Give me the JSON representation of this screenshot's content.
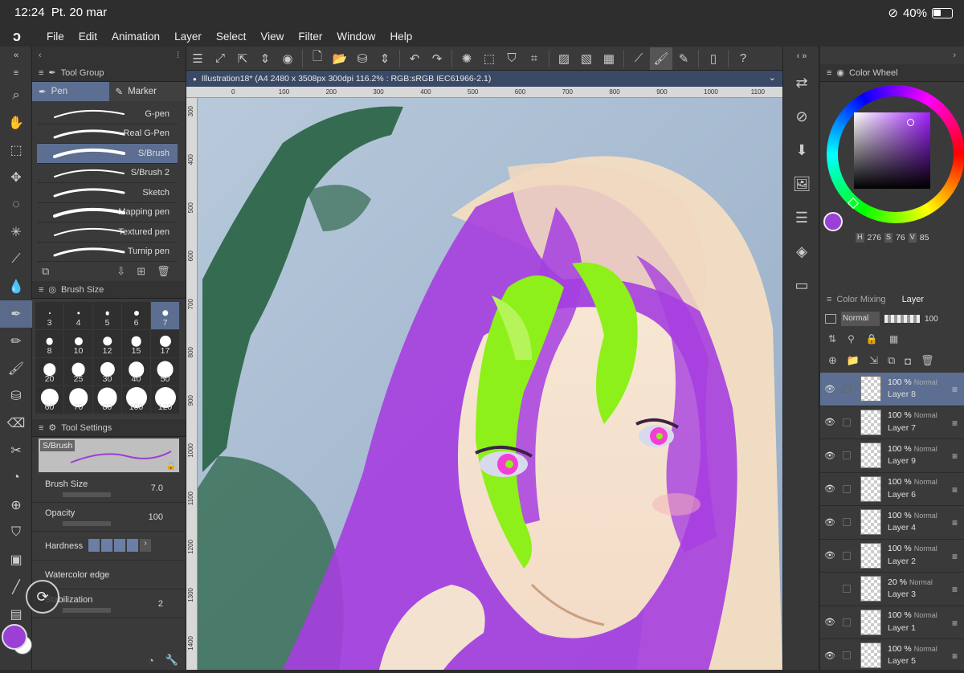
{
  "status": {
    "time": "12:24",
    "date": "Pt. 20 mar",
    "battery": "40%"
  },
  "menu": [
    "File",
    "Edit",
    "Animation",
    "Layer",
    "Select",
    "View",
    "Filter",
    "Window",
    "Help"
  ],
  "document": {
    "title": "Illustration18* (A4 2480 x 3508px 300dpi 116.2% : RGB:sRGB IEC61966-2.1)"
  },
  "ruler_h": [
    "0",
    "100",
    "200",
    "300",
    "400",
    "500",
    "600",
    "700",
    "800",
    "900",
    "1000",
    "1100"
  ],
  "ruler_v": [
    "300",
    "400",
    "500",
    "600",
    "700",
    "800",
    "900",
    "1000",
    "1100",
    "1200",
    "1300",
    "1400"
  ],
  "tool_group": {
    "title": "Tool Group",
    "tabs": [
      {
        "label": "Pen",
        "active": true
      },
      {
        "label": "Marker",
        "active": false
      }
    ],
    "brushes": [
      {
        "label": "G-pen",
        "active": false
      },
      {
        "label": "Real G-Pen",
        "active": false
      },
      {
        "label": "S/Brush",
        "active": true
      },
      {
        "label": "S/Brush 2",
        "active": false
      },
      {
        "label": "Sketch",
        "active": false
      },
      {
        "label": "Mapping pen",
        "active": false
      },
      {
        "label": "Textured pen",
        "active": false
      },
      {
        "label": "Turnip pen",
        "active": false
      }
    ]
  },
  "brush_size": {
    "title": "Brush Size",
    "sizes": [
      "3",
      "4",
      "5",
      "6",
      "7",
      "8",
      "10",
      "12",
      "15",
      "17",
      "20",
      "25",
      "30",
      "40",
      "50",
      "60",
      "70",
      "80",
      "100",
      "120"
    ],
    "selected": "7"
  },
  "tool_settings": {
    "title": "Tool Settings",
    "brush_name": "S/Brush",
    "rows": [
      {
        "label": "Brush Size",
        "value": "7.0"
      },
      {
        "label": "Opacity",
        "value": "100"
      },
      {
        "label": "Hardness",
        "value": ""
      },
      {
        "label": "Watercolor edge",
        "value": ""
      },
      {
        "label": "Stabilization",
        "value": "2"
      }
    ]
  },
  "color_wheel": {
    "title": "Color Wheel",
    "h_label": "H",
    "h": "276",
    "s_label": "S",
    "s": "76",
    "v_label": "V",
    "v": "85",
    "main_color": "#9b3fd6"
  },
  "layer_panel": {
    "tabs": [
      "Color Mixing",
      "Layer"
    ],
    "blend_mode": "Normal",
    "opacity": "100",
    "layers": [
      {
        "pct": "100 %",
        "mode": "Normal",
        "name": "Layer 8",
        "active": true,
        "visible": true
      },
      {
        "pct": "100 %",
        "mode": "Normal",
        "name": "Layer 7",
        "active": false,
        "visible": true
      },
      {
        "pct": "100 %",
        "mode": "Normal",
        "name": "Layer 9",
        "active": false,
        "visible": true
      },
      {
        "pct": "100 %",
        "mode": "Normal",
        "name": "Layer 6",
        "active": false,
        "visible": true
      },
      {
        "pct": "100 %",
        "mode": "Normal",
        "name": "Layer 4",
        "active": false,
        "visible": true
      },
      {
        "pct": "100 %",
        "mode": "Normal",
        "name": "Layer 2",
        "active": false,
        "visible": true
      },
      {
        "pct": "20 %",
        "mode": "Normal",
        "name": "Layer 3",
        "active": false,
        "visible": false
      },
      {
        "pct": "100 %",
        "mode": "Normal",
        "name": "Layer 1",
        "active": false,
        "visible": true
      },
      {
        "pct": "100 %",
        "mode": "Normal",
        "name": "Layer 5",
        "active": false,
        "visible": true
      }
    ]
  },
  "colors": {
    "accent": "#5c6f92",
    "panel": "#3a3a3a",
    "hair_purple": "#a63ee0",
    "hair_green": "#8ef01a",
    "sky": "#a9bed6"
  }
}
